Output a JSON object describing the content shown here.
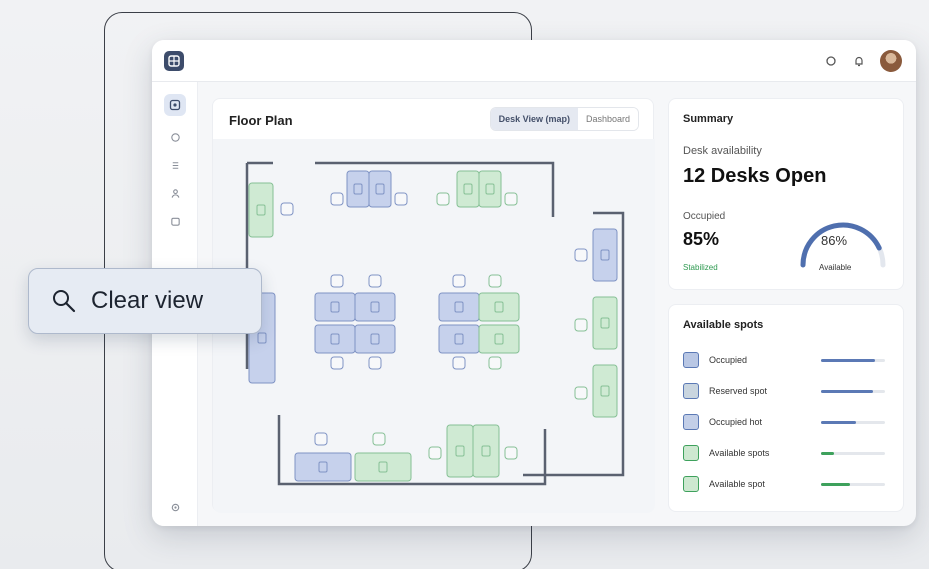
{
  "floor_plan": {
    "title": "Floor Plan",
    "view_options": [
      "Desk View (map)",
      "Dashboard"
    ]
  },
  "summary": {
    "title": "Summary",
    "subtitle": "Desk availability",
    "desks_open": "12 Desks Open",
    "occupied_label": "Occupied",
    "occupied_value": "85%",
    "trend_label": "Stabilized",
    "gauge_value": "86%",
    "gauge_fraction": 0.86,
    "gauge_caption": "Available"
  },
  "spots": {
    "title": "Available spots",
    "items": [
      {
        "label": "Occupied",
        "color": "#b9c7e4",
        "level": 0.85,
        "bar": "#5b79b5"
      },
      {
        "label": "Reserved spot",
        "color": "#c9d5df",
        "level": 0.82,
        "bar": "#5b79b5"
      },
      {
        "label": "Occupied hot",
        "color": "#c3cfe8",
        "level": 0.55,
        "bar": "#5b79b5"
      },
      {
        "label": "Available spots",
        "color": "#cde8d0",
        "level": 0.2,
        "bar": "#3ea15c"
      },
      {
        "label": "Available spot",
        "color": "#cde8d0",
        "level": 0.45,
        "bar": "#3ea15c"
      }
    ]
  },
  "clear_view": {
    "label": "Clear view",
    "icon": "search-icon"
  },
  "colors": {
    "desk_blue": "#c6d1ec",
    "desk_blue_stroke": "#7f93c4",
    "desk_green": "#cfead3",
    "desk_green_stroke": "#86c095",
    "wall": "#5a6170"
  }
}
